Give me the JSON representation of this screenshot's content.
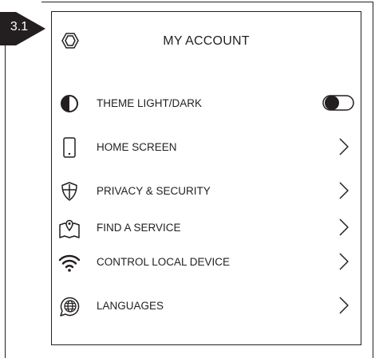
{
  "step": {
    "label": "3.1"
  },
  "header": {
    "title": "MY ACCOUNT",
    "icon": "hexagon-logo-icon"
  },
  "menu": [
    {
      "label": "THEME LIGHT/DARK",
      "icon": "contrast-icon",
      "control": "toggle"
    },
    {
      "label": "HOME SCREEN",
      "icon": "smartphone-icon",
      "control": "chevron"
    },
    {
      "label": "PRIVACY & SECURITY",
      "icon": "shield-icon",
      "control": "chevron"
    },
    {
      "label": "FIND A SERVICE",
      "icon": "map-pin-icon",
      "control": "chevron"
    },
    {
      "label": "CONTROL LOCAL DEVICE",
      "icon": "wifi-icon",
      "control": "chevron"
    },
    {
      "label": "LANGUAGES",
      "icon": "globe-icon",
      "control": "chevron"
    }
  ],
  "colors": {
    "ink": "#231f20",
    "background": "#ffffff"
  }
}
